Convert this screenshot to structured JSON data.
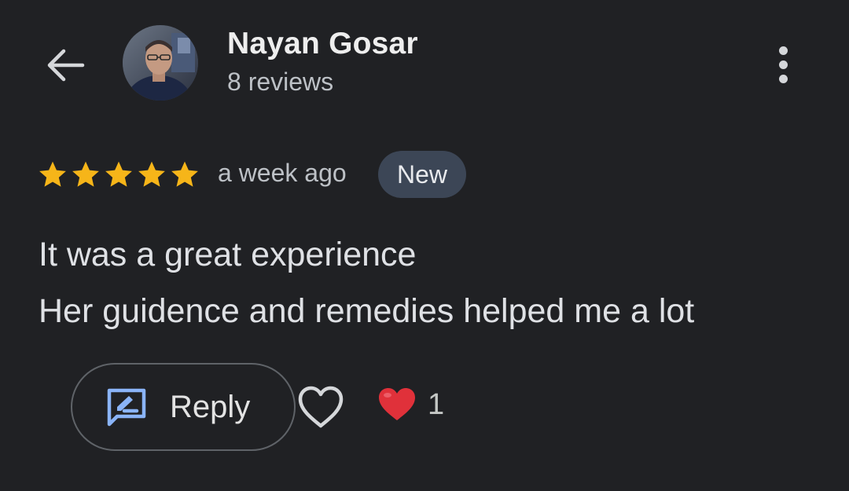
{
  "header": {
    "back_icon": "arrow-back-icon",
    "avatar_icon": "user-avatar",
    "user_name": "Nayan Gosar",
    "reviews_count": "8 reviews",
    "more_icon": "more-vert-icon"
  },
  "review": {
    "rating": 5,
    "rating_max": 5,
    "time_ago": "a week ago",
    "badge": "New",
    "text_lines": [
      "It was a great experience",
      "Her guidence and remedies helped me a lot"
    ]
  },
  "actions": {
    "reply_label": "Reply",
    "reply_icon": "reply-edit-icon",
    "like_icon": "heart-outline-icon",
    "reaction_icon": "red-heart-icon",
    "reaction_count": "1"
  },
  "colors": {
    "background": "#202124",
    "star": "#f6b519",
    "badge_bg": "#3c4656",
    "reply_icon": "#8ab4f8",
    "heart_red": "#e0313a"
  }
}
